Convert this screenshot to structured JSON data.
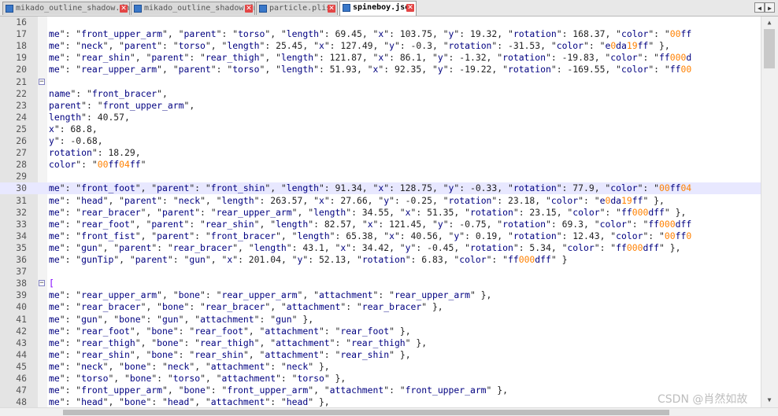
{
  "tabs": [
    {
      "label": "mikado_outline_shadow.fnt",
      "active": false
    },
    {
      "label": "mikado_outline_shadow.fnt",
      "active": false
    },
    {
      "label": "particle.plist",
      "active": false
    },
    {
      "label": "spineboy.json",
      "active": true
    }
  ],
  "nav": {
    "prev": "◀",
    "next": "▶"
  },
  "close_glyph": "✕",
  "fold_glyph": "−",
  "scroll": {
    "up": "▲",
    "down": "▼"
  },
  "watermark": "CSDN @肖然如故",
  "lines": [
    {
      "num": "16",
      "code": ""
    },
    {
      "num": "17",
      "code": "me\": \"front_upper_arm\", \"parent\": \"torso\", \"length\": 69.45, \"x\": 103.75, \"y\": 19.32, \"rotation\": 168.37, \"color\": \"00ff"
    },
    {
      "num": "18",
      "code": "me\": \"neck\", \"parent\": \"torso\", \"length\": 25.45, \"x\": 127.49, \"y\": -0.3, \"rotation\": -31.53, \"color\": \"e0da19ff\" },"
    },
    {
      "num": "19",
      "code": "me\": \"rear_shin\", \"parent\": \"rear_thigh\", \"length\": 121.87, \"x\": 86.1, \"y\": -1.32, \"rotation\": -19.83, \"color\": \"ff000d"
    },
    {
      "num": "20",
      "code": "me\": \"rear_upper_arm\", \"parent\": \"torso\", \"length\": 51.93, \"x\": 92.35, \"y\": -19.22, \"rotation\": -169.55, \"color\": \"ff00"
    },
    {
      "num": "21",
      "code": "",
      "fold": true
    },
    {
      "num": "22",
      "code": "name\": \"front_bracer\","
    },
    {
      "num": "23",
      "code": "parent\": \"front_upper_arm\","
    },
    {
      "num": "24",
      "code": "length\": 40.57,"
    },
    {
      "num": "25",
      "code": "x\": 68.8,"
    },
    {
      "num": "26",
      "code": "y\": -0.68,"
    },
    {
      "num": "27",
      "code": "rotation\": 18.29,"
    },
    {
      "num": "28",
      "code": "color\": \"00ff04ff\""
    },
    {
      "num": "29",
      "code": ""
    },
    {
      "num": "30",
      "code": "me\": \"front_foot\", \"parent\": \"front_shin\", \"length\": 91.34, \"x\": 128.75, \"y\": -0.33, \"rotation\": 77.9, \"color\": \"00ff04",
      "highlight": true
    },
    {
      "num": "31",
      "code": "me\": \"head\", \"parent\": \"neck\", \"length\": 263.57, \"x\": 27.66, \"y\": -0.25, \"rotation\": 23.18, \"color\": \"e0da19ff\" },"
    },
    {
      "num": "32",
      "code": "me\": \"rear_bracer\", \"parent\": \"rear_upper_arm\", \"length\": 34.55, \"x\": 51.35, \"rotation\": 23.15, \"color\": \"ff000dff\" },"
    },
    {
      "num": "33",
      "code": "me\": \"rear_foot\", \"parent\": \"rear_shin\", \"length\": 82.57, \"x\": 121.45, \"y\": -0.75, \"rotation\": 69.3, \"color\": \"ff000dff"
    },
    {
      "num": "34",
      "code": "me\": \"front_fist\", \"parent\": \"front_bracer\", \"length\": 65.38, \"x\": 40.56, \"y\": 0.19, \"rotation\": 12.43, \"color\": \"00ff0"
    },
    {
      "num": "35",
      "code": "me\": \"gun\", \"parent\": \"rear_bracer\", \"length\": 43.1, \"x\": 34.42, \"y\": -0.45, \"rotation\": 5.34, \"color\": \"ff000dff\" },"
    },
    {
      "num": "36",
      "code": "me\": \"gunTip\", \"parent\": \"gun\", \"x\": 201.04, \"y\": 52.13, \"rotation\": 6.83, \"color\": \"ff000dff\" }"
    },
    {
      "num": "37",
      "code": ""
    },
    {
      "num": "38",
      "code": "[",
      "fold": true
    },
    {
      "num": "39",
      "code": "me\": \"rear_upper_arm\", \"bone\": \"rear_upper_arm\", \"attachment\": \"rear_upper_arm\" },"
    },
    {
      "num": "40",
      "code": "me\": \"rear_bracer\", \"bone\": \"rear_bracer\", \"attachment\": \"rear_bracer\" },"
    },
    {
      "num": "41",
      "code": "me\": \"gun\", \"bone\": \"gun\", \"attachment\": \"gun\" },"
    },
    {
      "num": "42",
      "code": "me\": \"rear_foot\", \"bone\": \"rear_foot\", \"attachment\": \"rear_foot\" },"
    },
    {
      "num": "43",
      "code": "me\": \"rear_thigh\", \"bone\": \"rear_thigh\", \"attachment\": \"rear_thigh\" },"
    },
    {
      "num": "44",
      "code": "me\": \"rear_shin\", \"bone\": \"rear_shin\", \"attachment\": \"rear_shin\" },"
    },
    {
      "num": "45",
      "code": "me\": \"neck\", \"bone\": \"neck\", \"attachment\": \"neck\" },"
    },
    {
      "num": "46",
      "code": "me\": \"torso\", \"bone\": \"torso\", \"attachment\": \"torso\" },"
    },
    {
      "num": "47",
      "code": "me\": \"front_upper_arm\", \"bone\": \"front_upper_arm\", \"attachment\": \"front_upper_arm\" },"
    },
    {
      "num": "48",
      "code": "me\": \"head\", \"bone\": \"head\", \"attachment\": \"head\" },"
    }
  ]
}
